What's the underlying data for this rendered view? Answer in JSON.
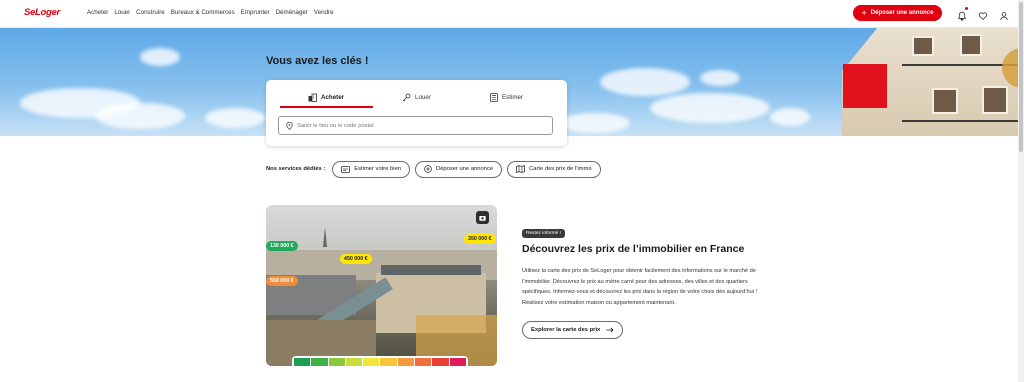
{
  "header": {
    "logo": "SeLoger",
    "nav": [
      "Acheter",
      "Louer",
      "Construire",
      "Bureaux & Commerces",
      "Emprunter",
      "Déménager",
      "Vendre"
    ],
    "cta": "Déposer une annonce",
    "icons": [
      "bell-icon",
      "heart-icon",
      "user-icon"
    ]
  },
  "hero": {
    "title": "Vous avez les clés !",
    "tabs": [
      {
        "label": "Acheter",
        "icon": "building-icon",
        "active": true
      },
      {
        "label": "Louer",
        "icon": "key-icon",
        "active": false
      },
      {
        "label": "Estimer",
        "icon": "calculator-icon",
        "active": false
      }
    ],
    "search": {
      "placeholder": "Saisir le lieu ou le code postal",
      "icon": "location-pin-icon"
    }
  },
  "services": {
    "label": "Nos services dédiés :",
    "items": [
      {
        "label": "Estimer votre bien",
        "icon": "estimate-icon"
      },
      {
        "label": "Déposer une annonce",
        "icon": "plus-circle-icon"
      },
      {
        "label": "Carte des prix de l’immo",
        "icon": "map-icon"
      }
    ]
  },
  "promo": {
    "badge": "Restez informé !",
    "title": "Découvrez les prix de l’immobilier en France",
    "body": "Utilisez la carte des prix de SeLoger pour obtenir facilement des informations sur le marché de l’immobilier. Découvrez le prix au mètre carré pour des adresses, des villes et des quartiers spécifiques. Informez-vous et découvrez les prix dans la région de votre choix dès aujourd’hui ! Réalisez votre estimation maison ou appartement maintenant.",
    "cta": "Explorer la carte des prix",
    "prices": [
      "130 000 €",
      "450 000 €",
      "550 000 €",
      "350 000 €"
    ],
    "colors": {
      "brand": "#e1000f",
      "green": "#1faa5c",
      "yellow": "#ffe500",
      "orange": "#f28c38"
    },
    "scale_colors": [
      "#1e9e55",
      "#3fb34a",
      "#8cc63f",
      "#c9dc3a",
      "#f2e53b",
      "#f7c43a",
      "#f59a3a",
      "#ef6e3a",
      "#e8413a",
      "#e01d5a"
    ]
  }
}
